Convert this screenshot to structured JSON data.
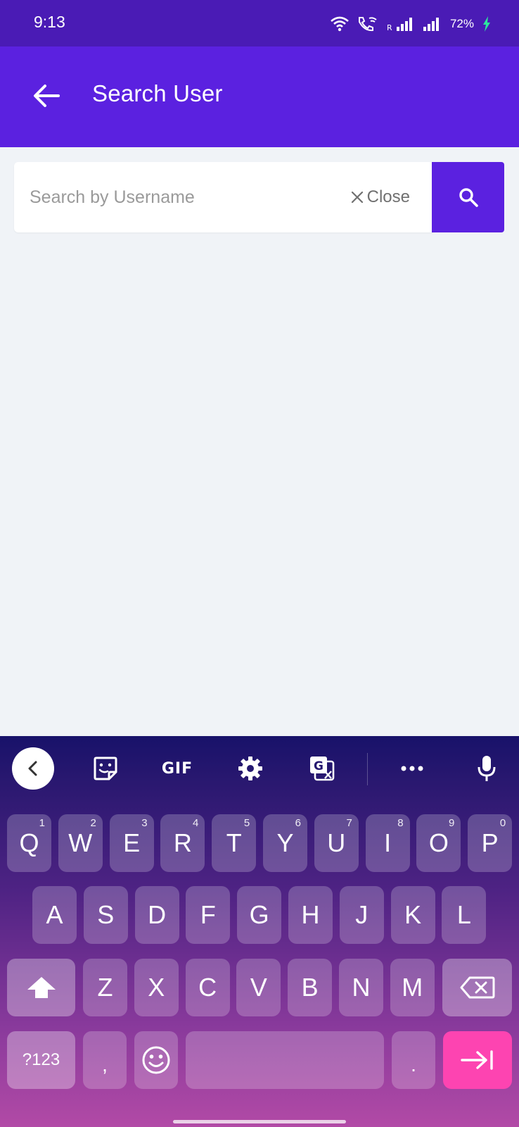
{
  "status_bar": {
    "time": "9:13",
    "battery": "72%",
    "icons": [
      "wifi-icon",
      "wifi-calling-icon",
      "roaming-signal-icon",
      "signal-icon",
      "battery-charging-icon"
    ]
  },
  "app_bar": {
    "title": "Search User",
    "back_icon": "arrow-left-icon"
  },
  "search": {
    "placeholder": "Search by Username",
    "value": "",
    "close_label": "Close",
    "button_icon": "search-icon"
  },
  "keyboard": {
    "toolbar": {
      "gif_label": "GIF",
      "icons": [
        "chevron-left-icon",
        "sticker-icon",
        "gif-icon",
        "gear-icon",
        "translate-icon",
        "more-icon",
        "microphone-icon"
      ]
    },
    "row1": [
      {
        "key": "Q",
        "hint": "1"
      },
      {
        "key": "W",
        "hint": "2"
      },
      {
        "key": "E",
        "hint": "3"
      },
      {
        "key": "R",
        "hint": "4"
      },
      {
        "key": "T",
        "hint": "5"
      },
      {
        "key": "Y",
        "hint": "6"
      },
      {
        "key": "U",
        "hint": "7"
      },
      {
        "key": "I",
        "hint": "8"
      },
      {
        "key": "O",
        "hint": "9"
      },
      {
        "key": "P",
        "hint": "0"
      }
    ],
    "row2": [
      "A",
      "S",
      "D",
      "F",
      "G",
      "H",
      "J",
      "K",
      "L"
    ],
    "row3": [
      "Z",
      "X",
      "C",
      "V",
      "B",
      "N",
      "M"
    ],
    "symbols_label": "?123",
    "comma_label": ",",
    "period_label": ".",
    "colors": {
      "accent": "#5b21e0",
      "status_bar": "#4a1bb5",
      "action_key": "#fd44b1"
    }
  }
}
